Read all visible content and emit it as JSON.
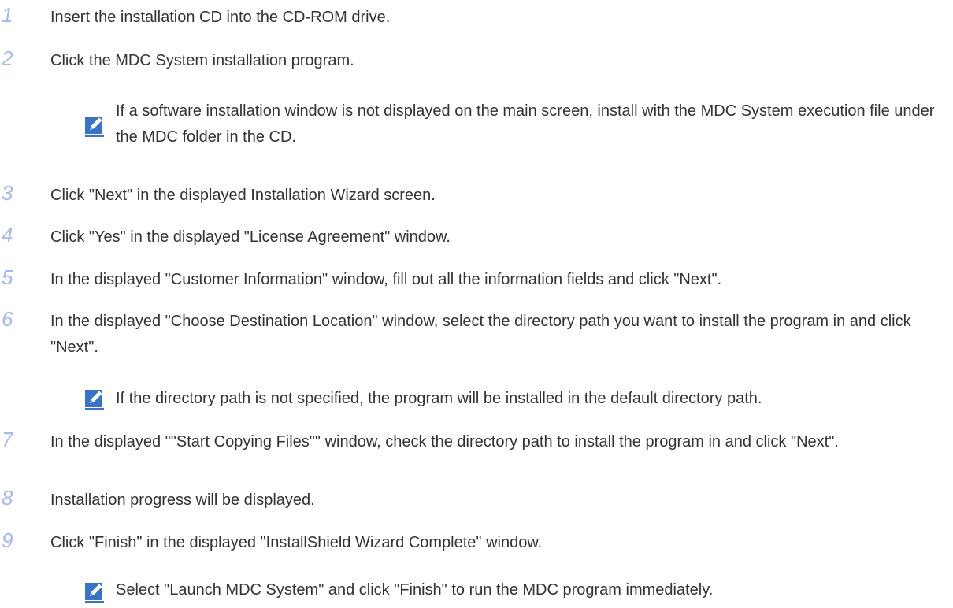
{
  "steps": [
    {
      "number": "1",
      "text": "Insert the installation CD into the CD-ROM drive."
    },
    {
      "number": "2",
      "text": "Click the MDC System installation program."
    },
    {
      "number": "3",
      "text": "Click \"Next\" in the displayed Installation Wizard screen."
    },
    {
      "number": "4",
      "text": "Click \"Yes\" in the displayed \"License Agreement\" window."
    },
    {
      "number": "5",
      "text": "In the displayed \"Customer Information\" window, fill out all the information fields and click \"Next\"."
    },
    {
      "number": "6",
      "text": "In the displayed \"Choose Destination Location\" window, select the directory path you want to install the program in and click \"Next\"."
    },
    {
      "number": "7",
      "text": "In the displayed \"\"Start Copying Files\"\" window, check the directory path to install the program in and click \"Next\"."
    },
    {
      "number": "8",
      "text": "Installation progress will be displayed."
    },
    {
      "number": "9",
      "text": "Click \"Finish\" in the displayed \"InstallShield Wizard Complete\" window."
    }
  ],
  "notes": [
    {
      "text": "If a software installation window is not displayed on the main screen, install with the MDC System execution file under the MDC folder in the CD."
    },
    {
      "text": "If the directory path is not specified, the program will be installed in the default directory path."
    },
    {
      "text": "Select \"Launch MDC System\" and click \"Finish\" to run the MDC program immediately."
    }
  ],
  "colors": {
    "step_number": "#a7b8f0",
    "note_icon": "#3a72c4",
    "text": "#333333"
  },
  "icons": {
    "note": "note-pencil-icon"
  }
}
